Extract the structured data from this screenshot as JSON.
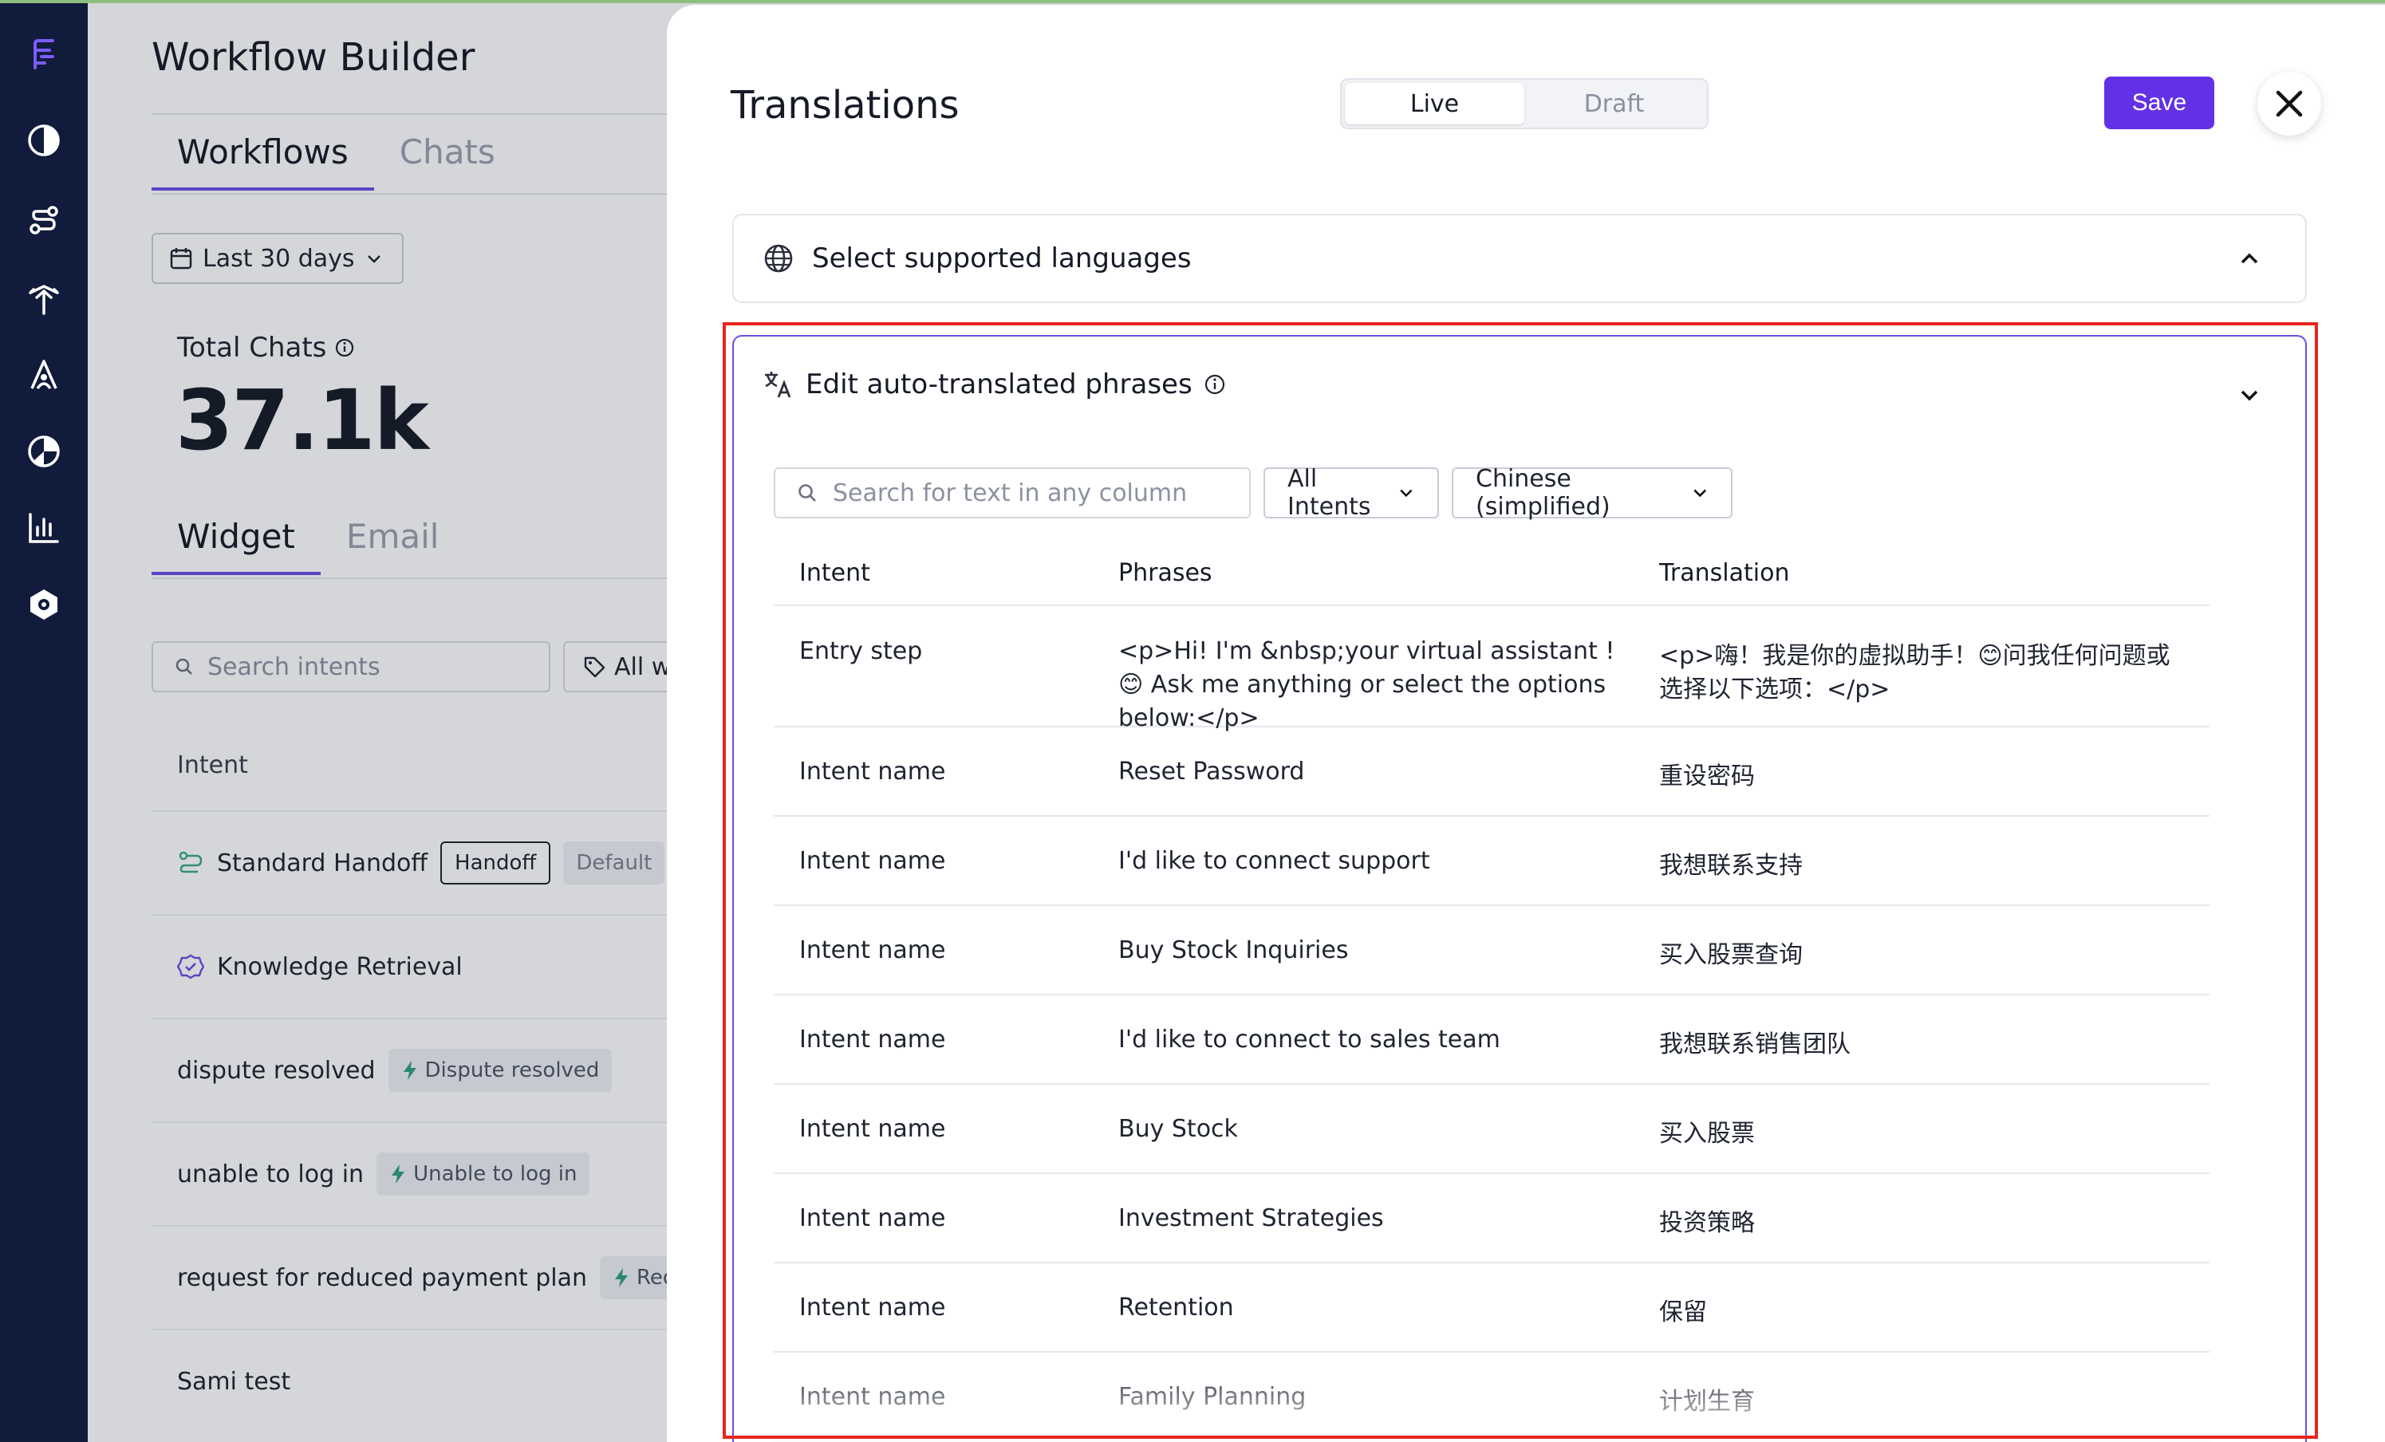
{
  "background": {
    "title": "Workflow Builder",
    "tabs": [
      "Workflows",
      "Chats"
    ],
    "date_range": "Last 30 days",
    "total_chats_label": "Total Chats",
    "total_chats_value": "37.1k",
    "sub_tabs": [
      "Widget",
      "Email"
    ],
    "search_placeholder": "Search intents",
    "filter_label": "All w",
    "column_intent": "Intent",
    "rows": [
      {
        "name": "Standard Handoff",
        "tag1": "Handoff",
        "tag2": "Default"
      },
      {
        "name": "Knowledge Retrieval"
      },
      {
        "name": "dispute resolved",
        "tag": "Dispute resolved"
      },
      {
        "name": "unable to log in",
        "tag": "Unable to log in"
      },
      {
        "name": "request for reduced payment plan",
        "tag": "Request"
      },
      {
        "name": "Sami test"
      }
    ]
  },
  "drawer": {
    "title": "Translations",
    "mode_live": "Live",
    "mode_draft": "Draft",
    "save_label": "Save",
    "languages_section": "Select supported languages",
    "phrases_section": "Edit auto-translated phrases",
    "search_placeholder": "Search for text in any column",
    "intents_filter": "All Intents",
    "language_filter": "Chinese (simplified)",
    "columns": {
      "intent": "Intent",
      "phrases": "Phrases",
      "translation": "Translation"
    },
    "rows": [
      {
        "intent": "Entry step",
        "phrase": "<p>Hi! I'm &nbsp;your virtual assistant !😊 Ask me anything or select the options below:</p>",
        "translation": "<p>嗨！我是你的虚拟助手！😊问我任何问题或选择以下选项：</p>"
      },
      {
        "intent": "Intent name",
        "phrase": "Reset Password",
        "translation": "重设密码"
      },
      {
        "intent": "Intent name",
        "phrase": "I'd like to connect support",
        "translation": "我想联系支持"
      },
      {
        "intent": "Intent name",
        "phrase": "Buy Stock Inquiries",
        "translation": "买入股票查询"
      },
      {
        "intent": "Intent name",
        "phrase": "I'd like to connect to sales team",
        "translation": "我想联系销售团队"
      },
      {
        "intent": "Intent name",
        "phrase": "Buy Stock",
        "translation": "买入股票"
      },
      {
        "intent": "Intent name",
        "phrase": "Investment Strategies",
        "translation": "投资策略"
      },
      {
        "intent": "Intent name",
        "phrase": "Retention",
        "translation": "保留"
      },
      {
        "intent": "Intent name",
        "phrase": "Family Planning",
        "translation": "计划生育"
      }
    ]
  },
  "colors": {
    "accent": "#6231e6",
    "highlight": "#e8261c",
    "rail": "#111b3b"
  }
}
